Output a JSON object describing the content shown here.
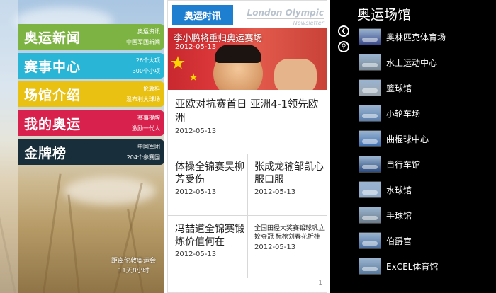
{
  "home": {
    "tiles": [
      {
        "title": "奥运新闻",
        "sub1": "奥运资讯",
        "sub2": "中国军团新闻",
        "color": "#7cb342"
      },
      {
        "title": "赛事中心",
        "sub1": "26个大项",
        "sub2": "300个小项",
        "color": "#29b6d6"
      },
      {
        "title": "场馆介绍",
        "sub1": "伦敦科",
        "sub2": "温布利大球场",
        "color": "#e8c112"
      },
      {
        "title": "我的奥运",
        "sub1": "赛事提醒",
        "sub2": "激励一代人",
        "color": "#d8224d"
      },
      {
        "title": "金牌榜",
        "sub1": "中国军团",
        "sub2": "204个参赛国",
        "color": "#182e3a"
      }
    ],
    "countdown_line1": "距离伦敦奥运会",
    "countdown_line2": "11天8小时"
  },
  "news": {
    "tab_label": "奥运时讯",
    "brand_main": "London Olympic",
    "brand_sub": "Newsletter",
    "hero": {
      "headline": "李小鹏将重归奥运赛场",
      "date": "2012-05-13"
    },
    "item1": {
      "headline": "亚欧对抗赛首日 亚洲4-1领先欧洲",
      "date": "2012-05-13"
    },
    "grid": [
      {
        "headline": "体操全锦赛吴柳芳受伤",
        "date": "2012-05-13"
      },
      {
        "headline": "张成龙输邹凯心服口服",
        "date": "2012-05-13"
      },
      {
        "headline": "冯喆道全锦赛锻炼价值何在",
        "date": "2012-05-13"
      },
      {
        "headline": "全国田径大奖赛铅球巩立姣夺冠 标枪刘春花折桂",
        "date": "2012-05-13"
      }
    ],
    "page_number": "1"
  },
  "venues": {
    "title": "奥运场馆",
    "back_icon": "back-arrow-icon",
    "search_icon": "search-icon",
    "items": [
      {
        "name": "奥林匹克体育场",
        "thumb_color": "#3b4a8a"
      },
      {
        "name": "水上运动中心",
        "thumb_color": "#7a8a96"
      },
      {
        "name": "篮球馆",
        "thumb_color": "#9aa4ab"
      },
      {
        "name": "小轮车场",
        "thumb_color": "#5b7fae"
      },
      {
        "name": "曲棍球中心",
        "thumb_color": "#3f6fb0"
      },
      {
        "name": "自行车馆",
        "thumb_color": "#2e4d7e"
      },
      {
        "name": "水球馆",
        "thumb_color": "#8fa9c8"
      },
      {
        "name": "手球馆",
        "thumb_color": "#6b7a89"
      },
      {
        "name": "伯爵宫",
        "thumb_color": "#4a6ea0"
      },
      {
        "name": "ExCEL体育馆",
        "thumb_color": "#5a7a9c"
      }
    ]
  }
}
